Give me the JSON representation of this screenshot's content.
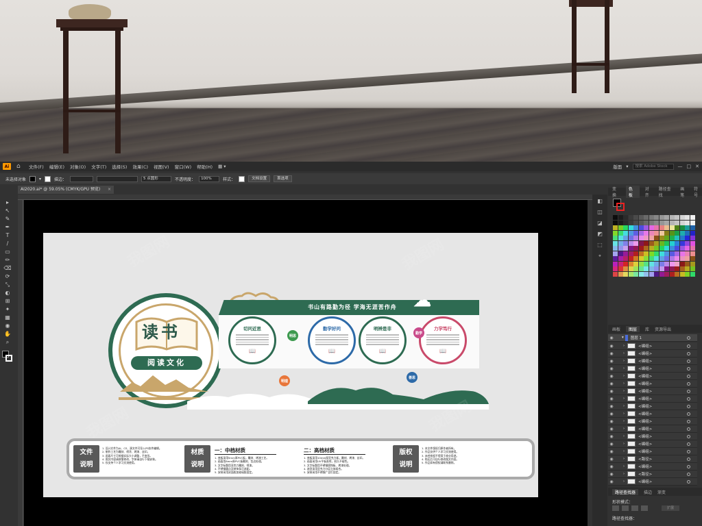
{
  "app": {
    "logo": "Ai",
    "menu": [
      "文件(F)",
      "编辑(E)",
      "对象(O)",
      "文字(T)",
      "选择(S)",
      "效果(C)",
      "视图(V)",
      "窗口(W)",
      "帮助(H)"
    ],
    "workspace": "版面",
    "stock_search": "搜索 Adobe Stock",
    "window_controls": [
      "—",
      "□",
      "✕"
    ]
  },
  "control_bar": {
    "selection": "未选择对象",
    "stroke_label": "描边：",
    "brush": "5 点圆形",
    "opacity_label": "不透明度：",
    "opacity": "100%",
    "style_label": "样式：",
    "doc_setup": "文档设置",
    "prefs": "首选项"
  },
  "document_tab": {
    "title": "AI2020.ai* @ 59.05% (CMYK/GPU 预览)",
    "close": "×"
  },
  "tools": [
    "▸",
    "↖",
    "✎",
    "✒",
    "T",
    "/",
    "▭",
    "✏",
    "⌫",
    "⟳",
    "⤡",
    "◐",
    "⊞",
    "✦",
    "▦",
    "◉",
    "✋",
    "⌕"
  ],
  "panel_icons": [
    "◧",
    "◫",
    "◪",
    "◩",
    "⬚",
    "⚬"
  ],
  "color_panel": {
    "tabs": [
      "变换",
      "色板",
      "对齐",
      "路径查找",
      "画笔",
      "符号"
    ],
    "active_tab": "色板"
  },
  "layers_panel": {
    "tabs": [
      "画板",
      "图层",
      "库",
      "资源导出"
    ],
    "active_tab": "图层",
    "layer_name": "图层 1",
    "rows": [
      "<编组>",
      "<编组>",
      "<编组>",
      "<编组>",
      "<编组>",
      "<编组>",
      "<编组>",
      "<编组>",
      "<编组>",
      "<编组>",
      "<编组>",
      "<编组>",
      "<编组>",
      "<编组>",
      "<编组>",
      "<路径>",
      "<编组>",
      "<路径>",
      "<编组>"
    ]
  },
  "path_panel": {
    "tabs": [
      "路径查找器",
      "描边",
      "渐变"
    ],
    "active_tab": "路径查找器",
    "shape_modes_label": "形状模式：",
    "pathfinder_label": "路径查找器：",
    "expand": "扩展"
  },
  "design": {
    "title": "读书",
    "subtitle": "阅读文化",
    "banner": "书山有路勤为径  学海无涯苦作舟",
    "cards": [
      {
        "title": "切问近思",
        "color": "#2e6b52"
      },
      {
        "title": "勤学好问",
        "color": "#2d6aa8"
      },
      {
        "title": "明辨是非",
        "color": "#2e6b52"
      },
      {
        "title": "力学笃行",
        "color": "#c94a6a"
      }
    ],
    "small_circles": [
      {
        "label": "明思",
        "color": "#3d9a4f"
      },
      {
        "label": "明理",
        "color": "#e8763a"
      },
      {
        "label": "勤学",
        "color": "#c94a8a"
      },
      {
        "label": "善思",
        "color": "#2d6aa8"
      }
    ],
    "bottom": {
      "file_label": [
        "文件",
        "说明"
      ],
      "material_label": [
        "材质",
        "说明"
      ],
      "copyright_label": [
        "版权",
        "说明"
      ],
      "mid_header": "一：中档材质",
      "high_header": "二：高档材质",
      "file_lines": [
        "1. 设计文件为AI、CS、源文件可导入PS软件编辑。",
        "2. 制作工艺为雕刻、喷涂、烤漆、丝印。",
        "3. 画面尺寸可根据实际大小调整，不变形。",
        "4. 图文内容请按需修改，字体请自行下载安装。",
        "5. 仅支持个人学习交流使用。"
      ],
      "mid_lines": [
        "1. 底板采用5mm厚PVC板，雕刻、烤漆工艺。",
        "2. 画面用8mm厚PVC板雕刻、包边处理。",
        "3. 文字标题用亚克力雕刻、喷漆。",
        "4. 不锈钢圆点及装饰条可选配。",
        "5. 安装采用双面胶加玻璃胶固定。"
      ],
      "high_lines": [
        "1. 底板采用10mm厚亚克力板，雕刻、烤漆、丝印。",
        "2. 画面采用UV平板直喷，耐久不褪色。",
        "3. 文字标题用不锈钢腐蚀板、烤漆处理。",
        "4. 造型采用亚克力分层立体组合。",
        "5. 安装采用不锈钢广告钉固定。"
      ],
      "copyright_lines": [
        "1. 本文件版权归原作者所有。",
        "2. 作品仅供个人学习交流使用。",
        "3. 未经授权不得用于商业用途。",
        "4. 购买后可自行修改图文内容。",
        "5. 作品如有侵权请联系删除。"
      ]
    }
  },
  "colors": {
    "accent_green": "#2e6b52",
    "gold": "#c9a66b",
    "ai_orange": "#ff9a00"
  }
}
